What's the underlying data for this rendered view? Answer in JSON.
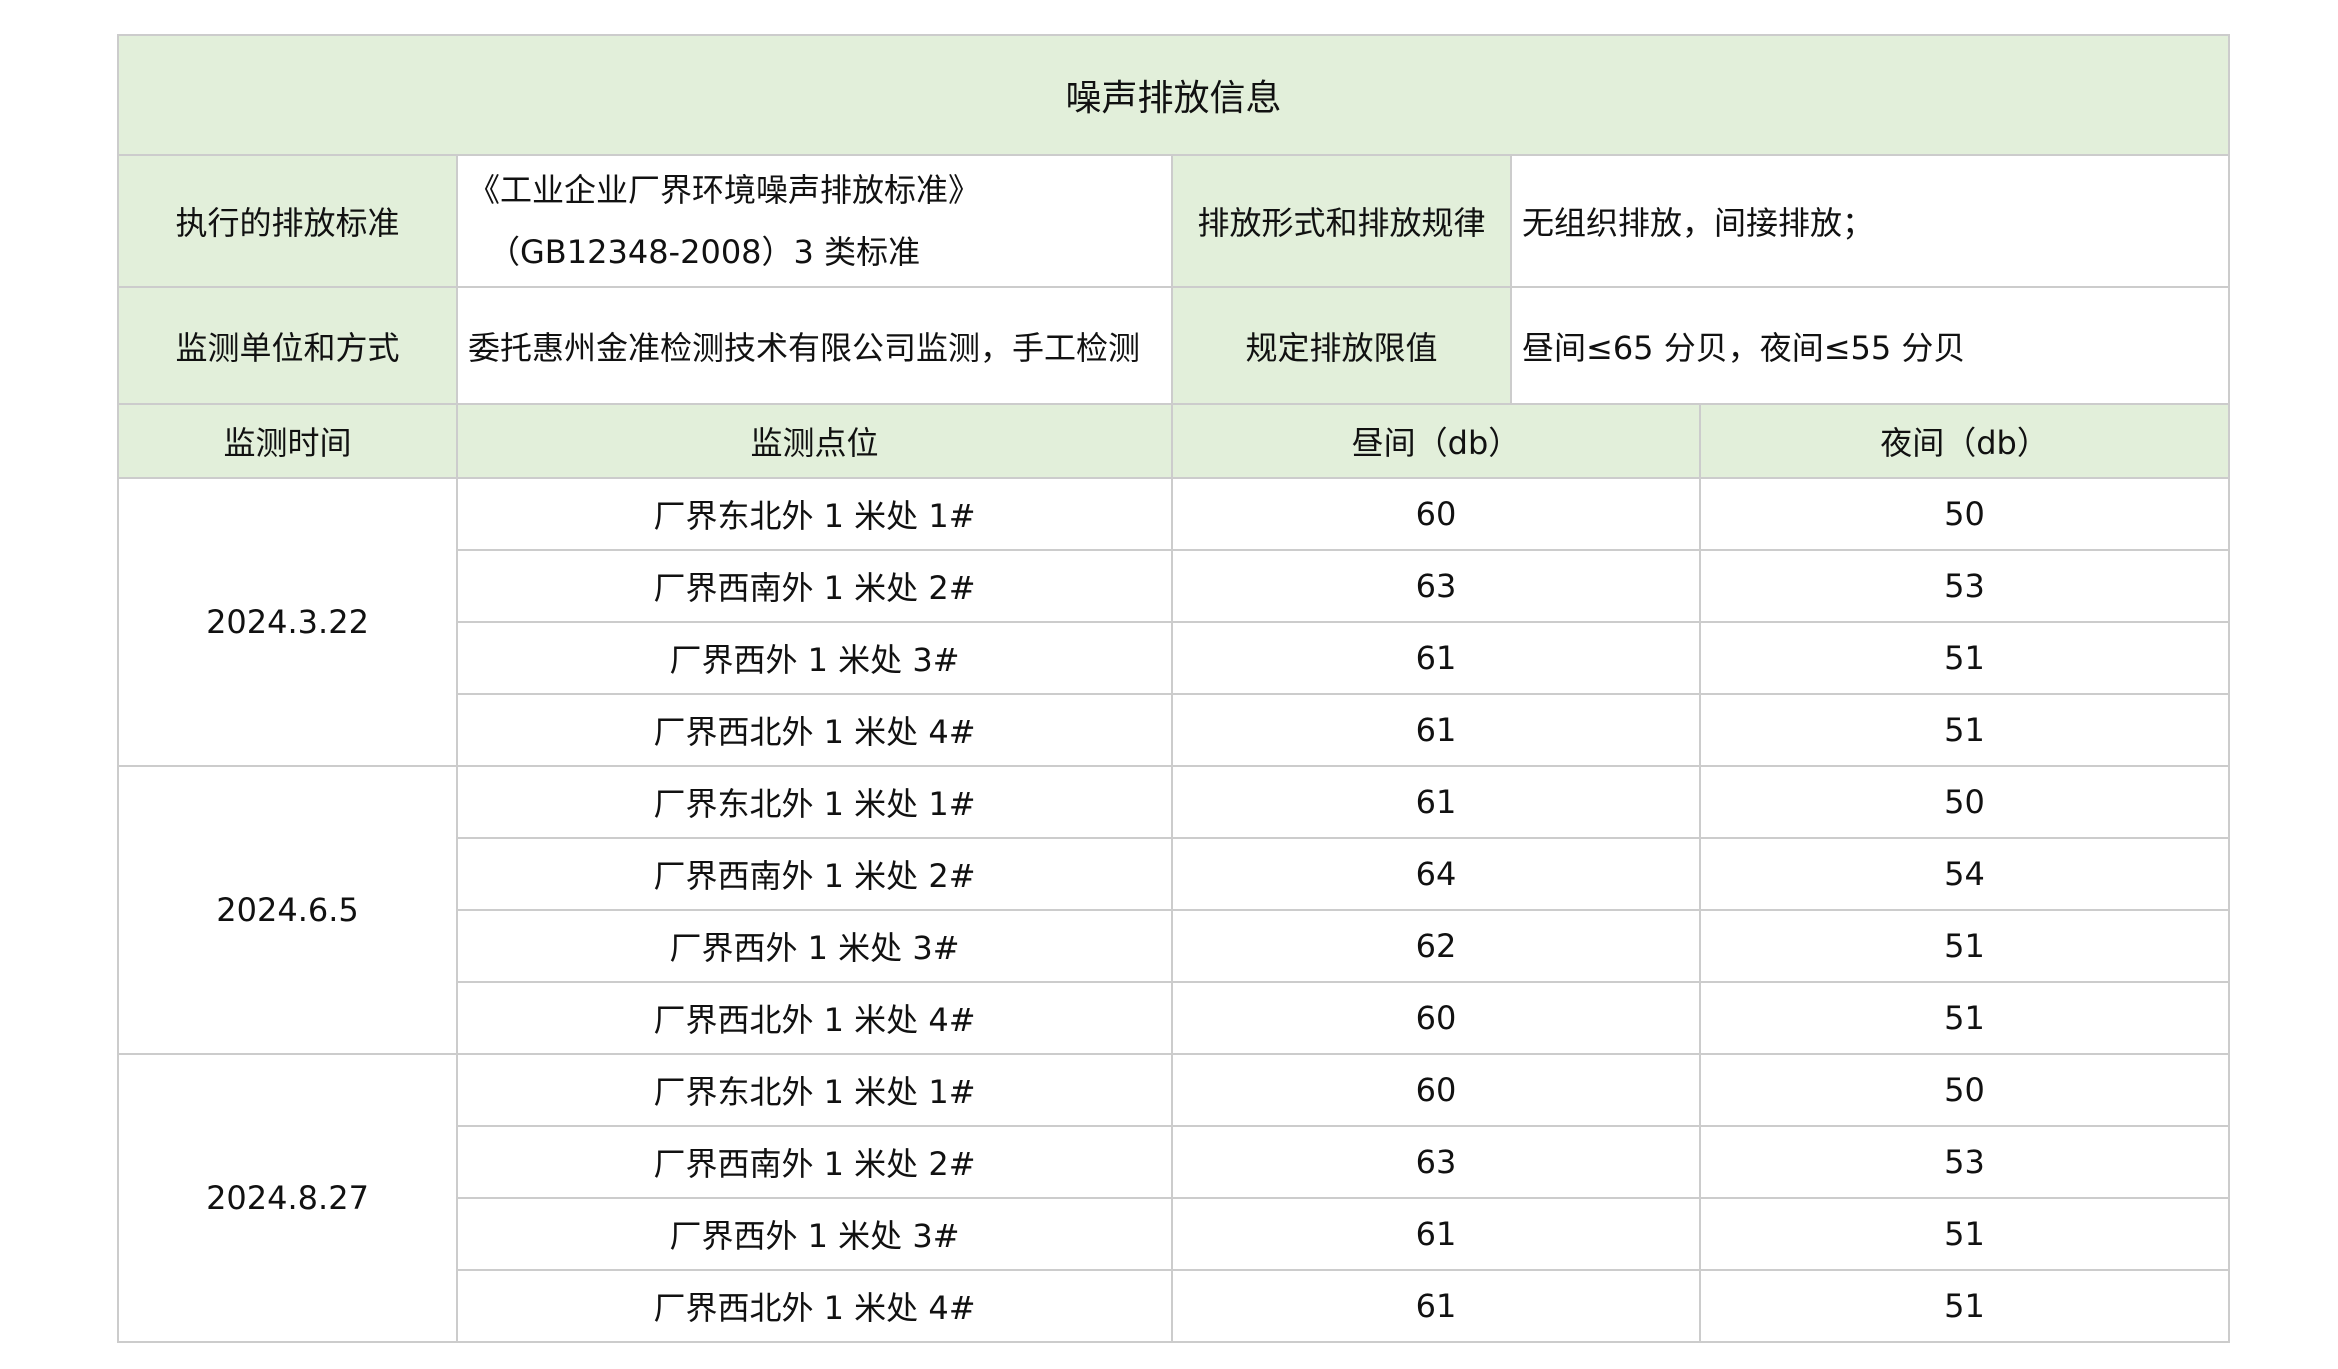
{
  "title": "噪声排放信息",
  "info": {
    "standard_label": "执行的排放标准",
    "standard_value_line1": "《工业企业厂界环境噪声排放标准》",
    "standard_value_line2": "（GB12348-2008）3 类标准",
    "form_label": "排放形式和排放规律",
    "form_value": "无组织排放，间接排放；",
    "unit_label": "监测单位和方式",
    "unit_value": "委托惠州金准检测技术有限公司监测，手工检测",
    "limit_label": "规定排放限值",
    "limit_value": "昼间≤65 分贝，夜间≤55 分贝"
  },
  "columns": [
    "监测时间",
    "监测点位",
    "昼间（db）",
    "夜间（db）"
  ],
  "groups": [
    {
      "date": "2024.3.22",
      "rows": [
        {
          "point": "厂界东北外 1 米处 1#",
          "day": "60",
          "night": "50"
        },
        {
          "point": "厂界西南外 1 米处 2#",
          "day": "63",
          "night": "53"
        },
        {
          "point": "厂界西外 1 米处 3#",
          "day": "61",
          "night": "51"
        },
        {
          "point": "厂界西北外 1 米处 4#",
          "day": "61",
          "night": "51"
        }
      ]
    },
    {
      "date": "2024.6.5",
      "rows": [
        {
          "point": "厂界东北外 1 米处 1#",
          "day": "61",
          "night": "50"
        },
        {
          "point": "厂界西南外 1 米处 2#",
          "day": "64",
          "night": "54"
        },
        {
          "point": "厂界西外 1 米处 3#",
          "day": "62",
          "night": "51"
        },
        {
          "point": "厂界西北外 1 米处 4#",
          "day": "60",
          "night": "51"
        }
      ]
    },
    {
      "date": "2024.8.27",
      "rows": [
        {
          "point": "厂界东北外 1 米处 1#",
          "day": "60",
          "night": "50"
        },
        {
          "point": "厂界西南外 1 米处 2#",
          "day": "63",
          "night": "53"
        },
        {
          "point": "厂界西外 1 米处 3#",
          "day": "61",
          "night": "51"
        },
        {
          "point": "厂界西北外 1 米处 4#",
          "day": "61",
          "night": "51"
        }
      ]
    }
  ],
  "colors": {
    "header_bg": "#e2efda",
    "border": "#cccccc",
    "text": "#111111"
  }
}
